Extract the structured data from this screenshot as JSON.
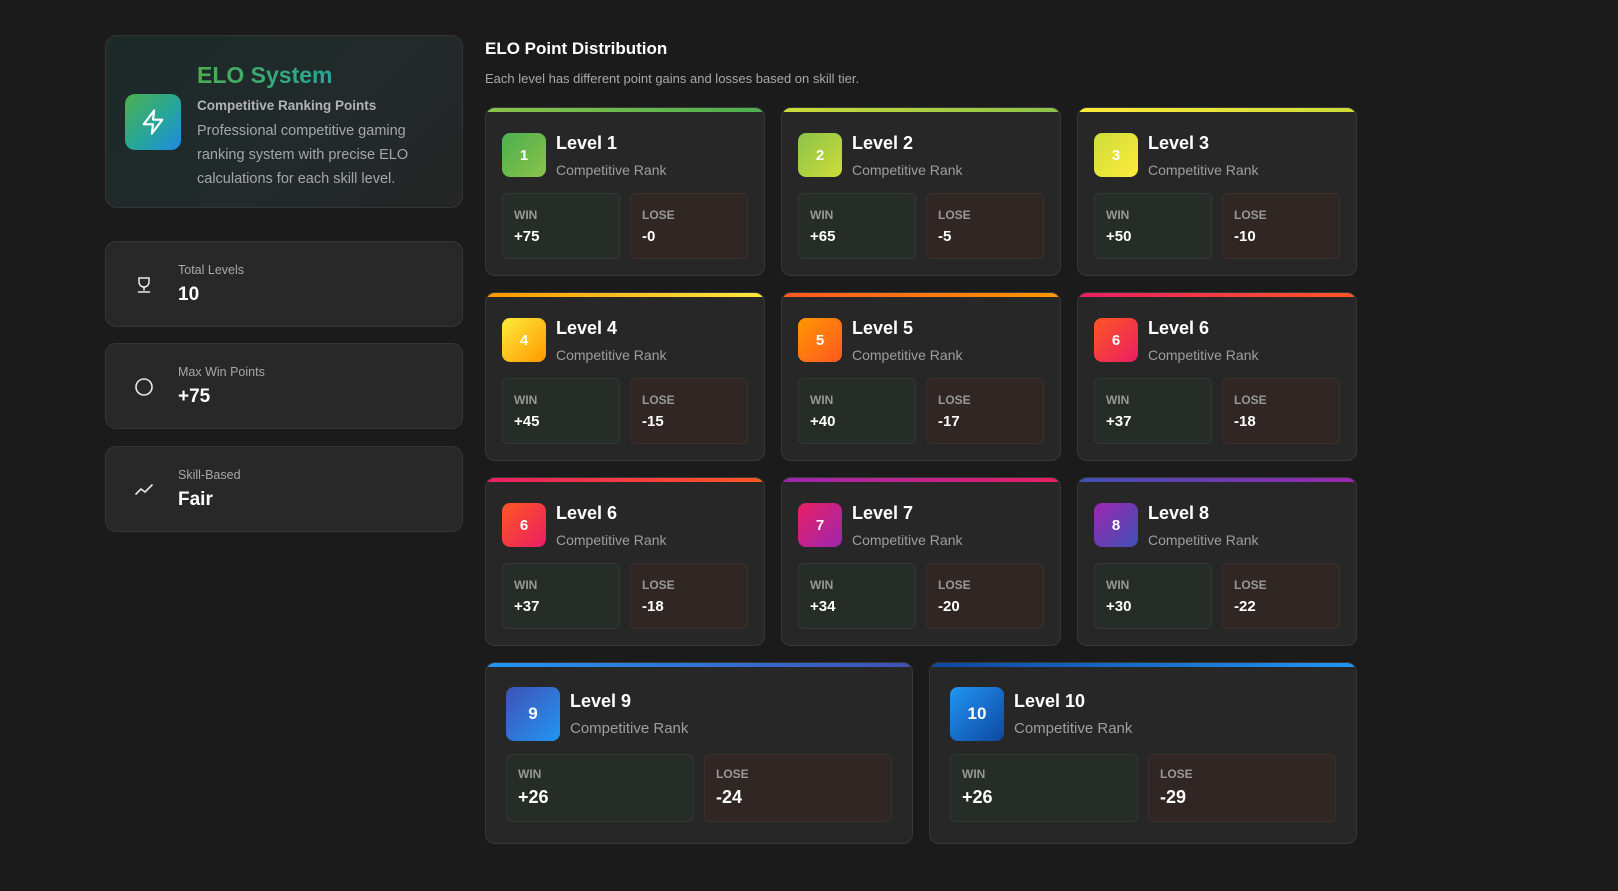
{
  "hero": {
    "title": "ELO System",
    "subtitle": "Competitive Ranking Points",
    "description": "Professional competitive gaming ranking system with precise ELO calculations for each skill level.",
    "icon": "lightning-icon"
  },
  "stats": [
    {
      "label": "Total Levels",
      "value": "10",
      "icon": "trophy-icon"
    },
    {
      "label": "Max Win Points",
      "value": "+75",
      "icon": "circle-icon"
    },
    {
      "label": "Skill-Based",
      "value": "Fair",
      "icon": "trend-line-icon"
    }
  ],
  "section": {
    "title": "ELO Point Distribution",
    "subtitle": "Each level has different point gains and losses based on skill tier."
  },
  "cards": [
    {
      "number": "1",
      "title": "Level 1",
      "rank": "Competitive Rank",
      "win_label": "WIN",
      "win": "+75",
      "lose_label": "LOSE",
      "lose": "-0",
      "colors": [
        "#8bc34a",
        "#4caf50"
      ]
    },
    {
      "number": "2",
      "title": "Level 2",
      "rank": "Competitive Rank",
      "win_label": "WIN",
      "win": "+65",
      "lose_label": "LOSE",
      "lose": "-5",
      "colors": [
        "#cddc39",
        "#8bc34a"
      ]
    },
    {
      "number": "3",
      "title": "Level 3",
      "rank": "Competitive Rank",
      "win_label": "WIN",
      "win": "+50",
      "lose_label": "LOSE",
      "lose": "-10",
      "colors": [
        "#ffeb3b",
        "#cddc39"
      ]
    },
    {
      "number": "4",
      "title": "Level 4",
      "rank": "Competitive Rank",
      "win_label": "WIN",
      "win": "+45",
      "lose_label": "LOSE",
      "lose": "-15",
      "colors": [
        "#ff9800",
        "#ffeb3b"
      ]
    },
    {
      "number": "5",
      "title": "Level 5",
      "rank": "Competitive Rank",
      "win_label": "WIN",
      "win": "+40",
      "lose_label": "LOSE",
      "lose": "-17",
      "colors": [
        "#ff5722",
        "#ff9800"
      ]
    },
    {
      "number": "6",
      "title": "Level 6",
      "rank": "Competitive Rank",
      "win_label": "WIN",
      "win": "+37",
      "lose_label": "LOSE",
      "lose": "-18",
      "colors": [
        "#e91e63",
        "#ff5722"
      ]
    },
    {
      "number": "6",
      "title": "Level 6",
      "rank": "Competitive Rank",
      "win_label": "WIN",
      "win": "+37",
      "lose_label": "LOSE",
      "lose": "-18",
      "colors": [
        "#e91e63",
        "#ff5722"
      ]
    },
    {
      "number": "7",
      "title": "Level 7",
      "rank": "Competitive Rank",
      "win_label": "WIN",
      "win": "+34",
      "lose_label": "LOSE",
      "lose": "-20",
      "colors": [
        "#9c27b0",
        "#e91e63"
      ]
    },
    {
      "number": "8",
      "title": "Level 8",
      "rank": "Competitive Rank",
      "win_label": "WIN",
      "win": "+30",
      "lose_label": "LOSE",
      "lose": "-22",
      "colors": [
        "#3f51b5",
        "#9c27b0"
      ]
    },
    {
      "number": "9",
      "title": "Level 9",
      "rank": "Competitive Rank",
      "win_label": "WIN",
      "win": "+26",
      "lose_label": "LOSE",
      "lose": "-24",
      "colors": [
        "#2196f3",
        "#3f51b5"
      ]
    },
    {
      "number": "10",
      "title": "Level 10",
      "rank": "Competitive Rank",
      "win_label": "WIN",
      "win": "+26",
      "lose_label": "LOSE",
      "lose": "-29",
      "colors": [
        "#0d47a1",
        "#2196f3"
      ]
    }
  ]
}
